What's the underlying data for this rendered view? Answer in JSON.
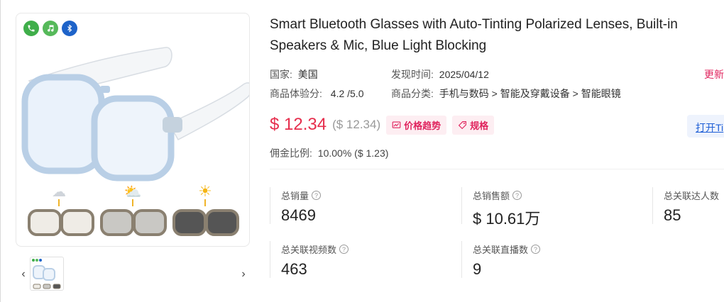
{
  "product": {
    "title_line1": "Smart Bluetooth Glasses with Auto-Tinting Polarized Lenses, Built-in",
    "title_line2": "Speakers & Mic, Blue Light Blocking"
  },
  "badges": [
    "phone-icon",
    "music-icon",
    "bluetooth-icon"
  ],
  "meta": {
    "country_label": "国家:",
    "country_value": "美国",
    "found_label": "发现时间:",
    "found_value": "2025/04/12",
    "rating_label": "商品体验分:",
    "rating_value": "4.2 /5.0",
    "category_label": "商品分类:",
    "category_value": "手机与数码 > 智能及穿戴设备 > 智能眼镜",
    "update_label": "更新"
  },
  "price": {
    "current": "$ 12.34",
    "original": "($ 12.34)",
    "trend_label": "价格趋势",
    "spec_label": "规格",
    "open_label": "打开Ti"
  },
  "commission": {
    "label": "佣金比例:",
    "value": "10.00% ($ 1.23)"
  },
  "stats": {
    "sales_label": "总销量",
    "sales_value": "8469",
    "revenue_label": "总销售额",
    "revenue_value": "$ 10.61万",
    "creators_label": "总关联达人数",
    "creators_value": "85",
    "videos_label": "总关联视频数",
    "videos_value": "463",
    "lives_label": "总关联直播数",
    "lives_value": "9"
  },
  "nav": {
    "prev": "‹",
    "next": "›"
  },
  "colors": {
    "price": "#e62e4d",
    "accent_pink": "#e0245e",
    "link_blue": "#1f5fd6"
  }
}
